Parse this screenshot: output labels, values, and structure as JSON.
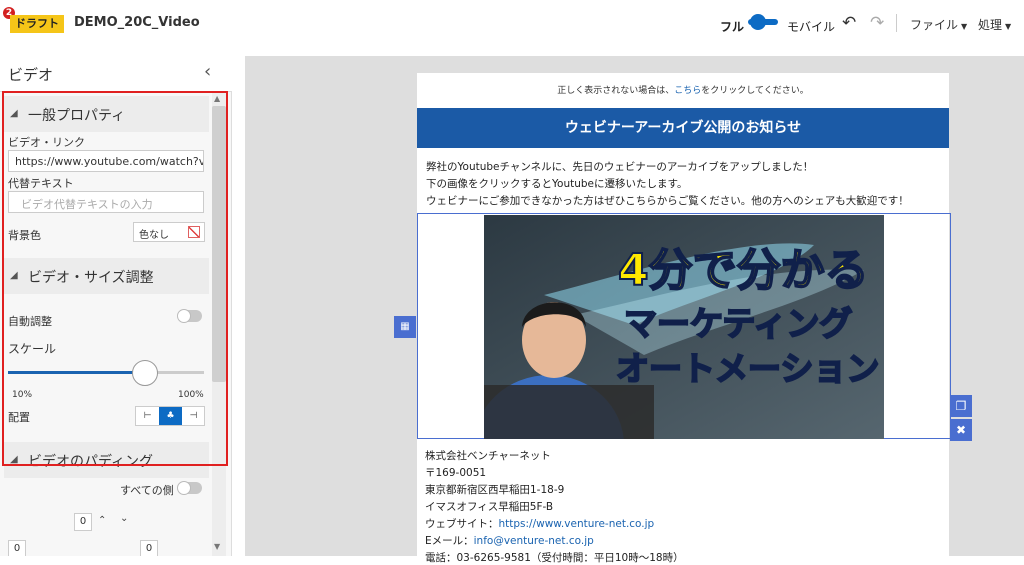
{
  "header": {
    "badge_count": "2",
    "status": "ドラフト",
    "title": "DEMO_20C_Video",
    "mode_full": "フル",
    "mode_mobile": "モバイル",
    "menu_file": "ファイル",
    "menu_process": "処理"
  },
  "panel": {
    "title": "ビデオ",
    "sec_general": "一般プロパティ",
    "video_link_label": "ビデオ・リンク",
    "video_link_value": "https://www.youtube.com/watch?v=gz",
    "alt_text_label": "代替テキスト",
    "alt_text_placeholder": "ビデオ代替テキストの入力",
    "bg_color_label": "背景色",
    "bg_color_value": "色なし",
    "sec_size": "ビデオ・サイズ調整",
    "auto_adjust_label": "自動調整",
    "scale_label": "スケール",
    "scale_min": "10%",
    "scale_max": "100%",
    "scale_value_fraction": 0.7,
    "align_label": "配置",
    "sec_padding": "ビデオのパディング",
    "all_sides_label": "すべての側",
    "pad_top": "0",
    "pad_left": "0",
    "pad_right": "0"
  },
  "email": {
    "notice_pre": "正しく表示されない場合は、",
    "notice_link": "こちら",
    "notice_post": "をクリックしてください。",
    "banner": "ウェビナーアーカイブ公開のお知らせ",
    "body_line1": "弊社のYoutubeチャンネルに、先日のウェビナーのアーカイブをアップしました！",
    "body_line2": "下の画像をクリックするとYoutubeに遷移いたします。",
    "body_line3": "ウェビナーにご参加できなかった方はぜひこちらからご覧ください。他の方へのシェアも大歓迎です！",
    "thumb_line1": "4分で分かる",
    "thumb_line2": "マーケティング",
    "thumb_line3": "オートメーション",
    "footer_company": "株式会社ベンチャーネット",
    "footer_zip": "〒169-0051",
    "footer_addr1": "東京都新宿区西早稲田1-18-9",
    "footer_addr2": "イマスオフィス早稲田5F-B",
    "footer_web_label": "ウェブサイト：",
    "footer_web_url": "https://www.venture-net.co.jp",
    "footer_mail_label": "Eメール：",
    "footer_mail": "info@venture-net.co.jp",
    "footer_tel": "電話：03-6265-9581（受付時間：平日10時〜18時）"
  },
  "colors": {
    "accent": "#0d6bc4",
    "banner": "#1b5aa6",
    "selection": "#4a6ed0",
    "highlight_frame": "#e02020",
    "draft_badge": "#f5c518",
    "thumb_title_yellow": "#ffe800"
  }
}
